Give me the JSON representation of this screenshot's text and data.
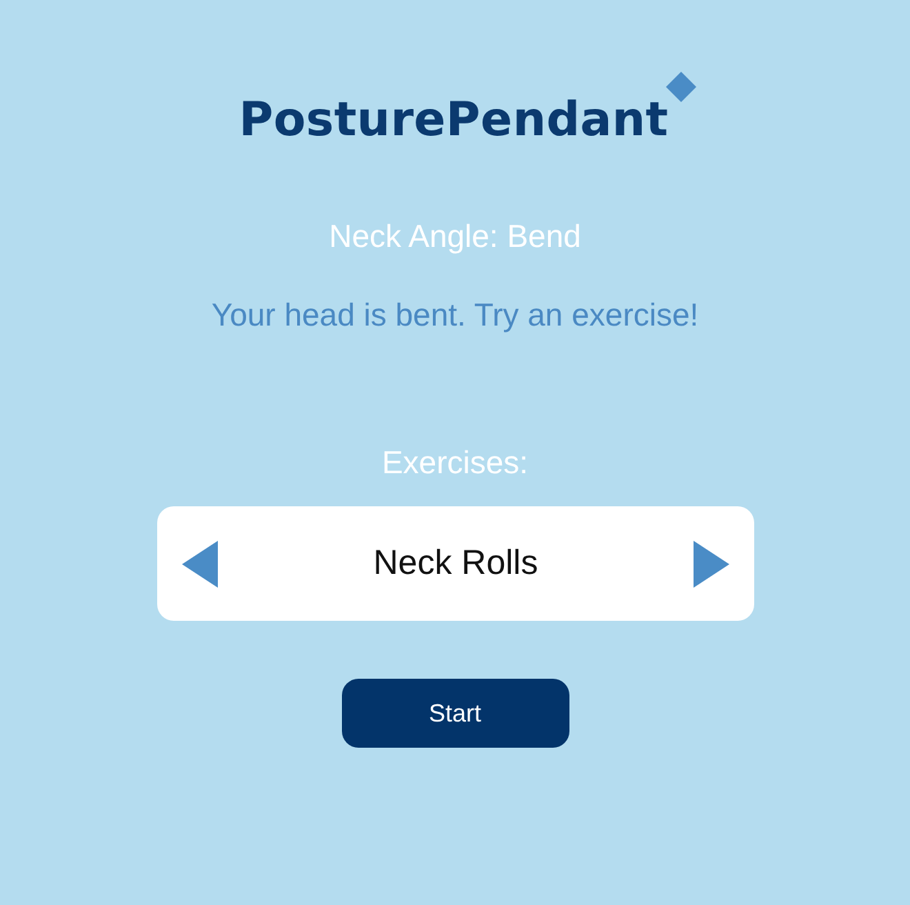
{
  "logo": {
    "text": "PosturePendant"
  },
  "status": {
    "label": "Neck Angle: Bend"
  },
  "message": "Your head is bent. Try an exercise!",
  "exercise_picker": {
    "label": "Exercises:",
    "current": "Neck Rolls"
  },
  "start_button": {
    "label": "Start"
  }
}
